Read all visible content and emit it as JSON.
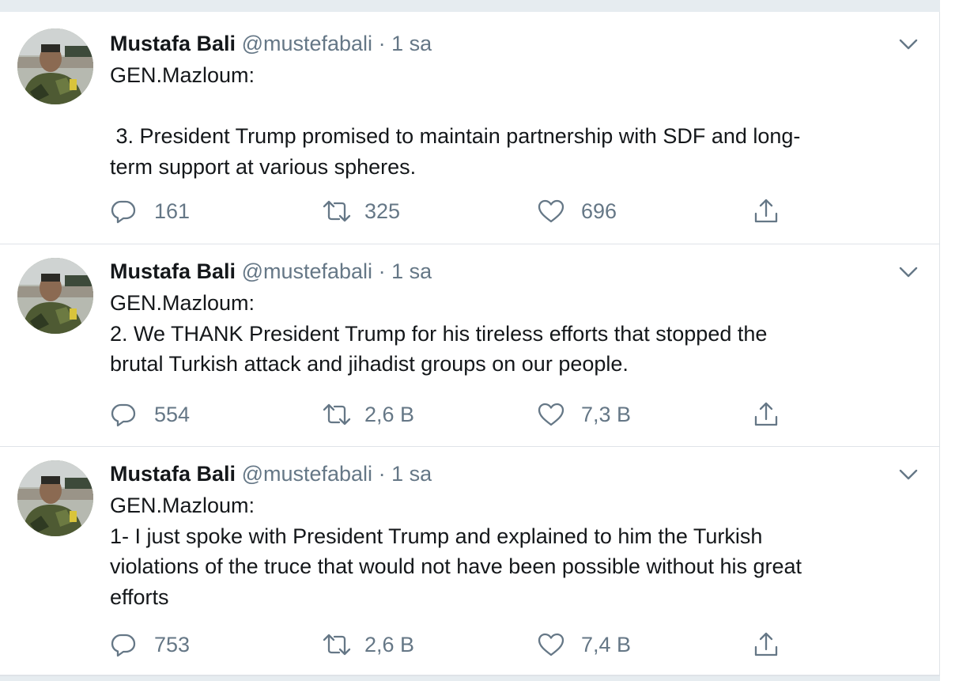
{
  "tweets": [
    {
      "author_name": "Mustafa Bali",
      "author_handle": "@mustefabali",
      "separator": "·",
      "time": "1 sa",
      "body_lines": [
        "GEN.Mazloum:",
        "",
        " 3. President Trump promised to maintain partnership with SDF and long-",
        "term support at various spheres."
      ],
      "replies": "161",
      "retweets": "325",
      "likes": "696"
    },
    {
      "author_name": "Mustafa Bali",
      "author_handle": "@mustefabali",
      "separator": "·",
      "time": "1 sa",
      "body_lines": [
        "GEN.Mazloum:",
        "2. We THANK President Trump for his tireless efforts that stopped the",
        "brutal Turkish attack and jihadist groups on our people."
      ],
      "replies": "554",
      "retweets": "2,6 B",
      "likes": "7,3 B"
    },
    {
      "author_name": "Mustafa Bali",
      "author_handle": "@mustefabali",
      "separator": "·",
      "time": "1 sa",
      "body_lines": [
        "GEN.Mazloum:",
        "1- I just spoke with President Trump and explained to him the Turkish",
        "violations of the truce that would not have been possible without his great",
        "efforts"
      ],
      "replies": "753",
      "retweets": "2,6 B",
      "likes": "7,4 B"
    }
  ],
  "icons": {
    "reply": "reply-icon",
    "retweet": "retweet-icon",
    "like": "heart-icon",
    "share": "share-icon",
    "caret": "chevron-down-icon"
  },
  "colors": {
    "text": "#14171a",
    "secondary": "#657786",
    "divider": "#dfe3e8",
    "page_background": "#e6ecf0"
  }
}
